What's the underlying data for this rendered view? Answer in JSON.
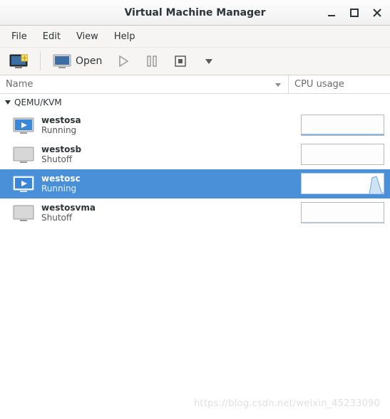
{
  "window": {
    "title": "Virtual Machine Manager"
  },
  "menubar": {
    "file": "File",
    "edit": "Edit",
    "view": "View",
    "help": "Help"
  },
  "toolbar": {
    "open_label": "Open"
  },
  "columns": {
    "name": "Name",
    "cpu": "CPU usage"
  },
  "hypervisor": {
    "label": "QEMU/KVM"
  },
  "vms": [
    {
      "name": "westosa",
      "status": "Running",
      "running": true,
      "selected": false,
      "graph": "low"
    },
    {
      "name": "westosb",
      "status": "Shutoff",
      "running": false,
      "selected": false,
      "graph": "none"
    },
    {
      "name": "westosc",
      "status": "Running",
      "running": true,
      "selected": true,
      "graph": "spike"
    },
    {
      "name": "westosvma",
      "status": "Shutoff",
      "running": false,
      "selected": false,
      "graph": "flat"
    }
  ],
  "watermark": "https://blog.csdn.net/weixin_45233090"
}
